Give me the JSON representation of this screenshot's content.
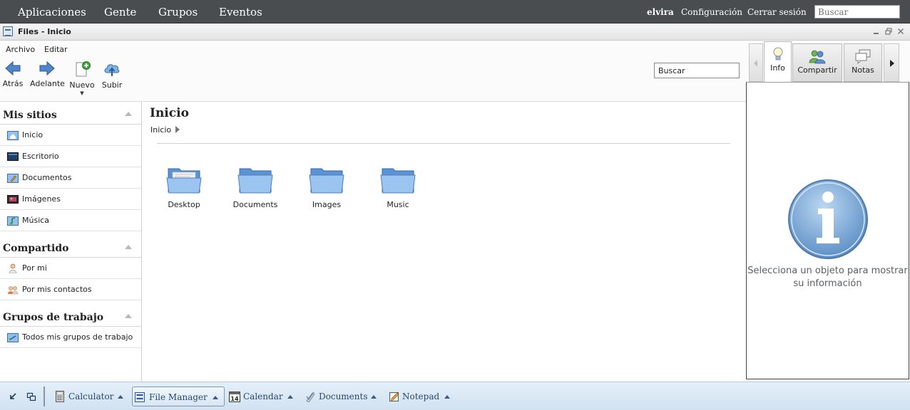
{
  "topbar": {
    "nav": [
      "Aplicaciones",
      "Gente",
      "Grupos",
      "Eventos"
    ],
    "user": "elvira",
    "settings": "Configuración",
    "logout": "Cerrar sesión",
    "search_placeholder": "Buscar"
  },
  "window": {
    "title": "Files - Inicio"
  },
  "menu": {
    "file": "Archivo",
    "edit": "Editar"
  },
  "toolbar": {
    "back": "Atrás",
    "forward": "Adelante",
    "new": "Nuevo",
    "upload": "Subir",
    "search_value": "Buscar"
  },
  "sidebar": {
    "my_sites": {
      "title": "Mis sitios",
      "items": [
        "Inicio",
        "Escritorio",
        "Documentos",
        "Imágenes",
        "Música"
      ]
    },
    "shared": {
      "title": "Compartido",
      "items": [
        "Por mi",
        "Por mis contactos"
      ]
    },
    "groups": {
      "title": "Grupos de trabajo",
      "items": [
        "Todos mis grupos de trabajo"
      ]
    }
  },
  "main": {
    "title": "Inicio",
    "breadcrumb": "Inicio",
    "folders": [
      "Desktop",
      "Documents",
      "Images",
      "Music"
    ]
  },
  "right_panel": {
    "tabs": [
      "Info",
      "Compartir",
      "Notas"
    ],
    "message": "Selecciona un objeto para mostrar su información"
  },
  "taskbar": {
    "tasks": [
      "Calculator",
      "File Manager",
      "Calendar",
      "Documents",
      "Notepad"
    ],
    "calendar_day": "14"
  },
  "colors": {
    "topbar": "#4a4d50",
    "taskbar": "#d8e6f4",
    "accent": "#28476b",
    "folder": "#6fa6e3"
  }
}
